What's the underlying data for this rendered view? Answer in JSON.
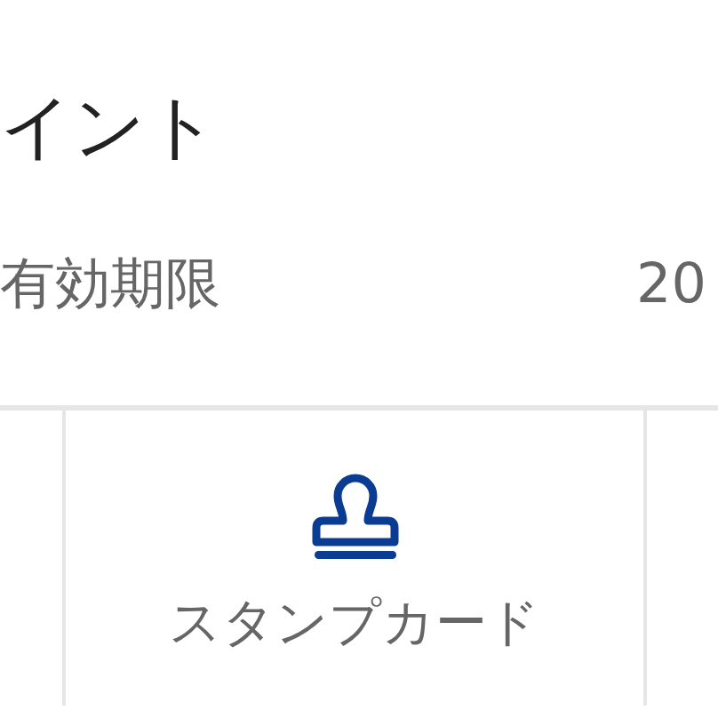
{
  "points": {
    "title": "イント",
    "expiry_label": "有効期限",
    "expiry_value": "20"
  },
  "menu": [
    {
      "kind": "empty"
    },
    {
      "kind": "stamp",
      "label": "スタンプカード"
    },
    {
      "kind": "empty"
    }
  ]
}
